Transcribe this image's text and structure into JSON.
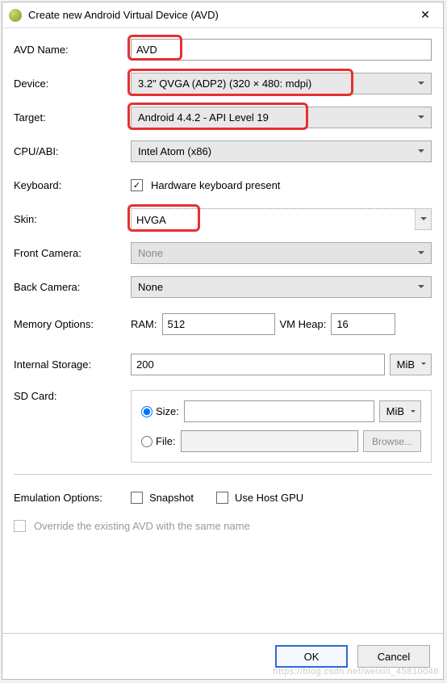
{
  "window": {
    "title": "Create new Android Virtual Device (AVD)"
  },
  "form": {
    "avd_name_label": "AVD Name:",
    "avd_name_value": "AVD",
    "device_label": "Device:",
    "device_value": "3.2\" QVGA (ADP2) (320 × 480: mdpi)",
    "target_label": "Target:",
    "target_value": "Android 4.4.2 - API Level 19",
    "cpu_label": "CPU/ABI:",
    "cpu_value": "Intel Atom (x86)",
    "keyboard_label": "Keyboard:",
    "keyboard_check_label": "Hardware keyboard present",
    "keyboard_checked": true,
    "skin_label": "Skin:",
    "skin_value": "HVGA",
    "front_camera_label": "Front Camera:",
    "front_camera_value": "None",
    "back_camera_label": "Back Camera:",
    "back_camera_value": "None",
    "memory_label": "Memory Options:",
    "ram_label": "RAM:",
    "ram_value": "512",
    "vmheap_label": "VM Heap:",
    "vmheap_value": "16",
    "internal_storage_label": "Internal Storage:",
    "internal_storage_value": "200",
    "internal_storage_unit": "MiB",
    "sdcard_label": "SD Card:",
    "sdcard_size_label": "Size:",
    "sdcard_size_value": "",
    "sdcard_size_unit": "MiB",
    "sdcard_file_label": "File:",
    "sdcard_file_value": "",
    "browse_label": "Browse...",
    "emulation_label": "Emulation Options:",
    "snapshot_label": "Snapshot",
    "usehostgpu_label": "Use Host GPU",
    "override_label": "Override the existing AVD with the same name"
  },
  "buttons": {
    "ok": "OK",
    "cancel": "Cancel"
  },
  "watermark": "https://blog.csdn.net/weixin_45810046"
}
